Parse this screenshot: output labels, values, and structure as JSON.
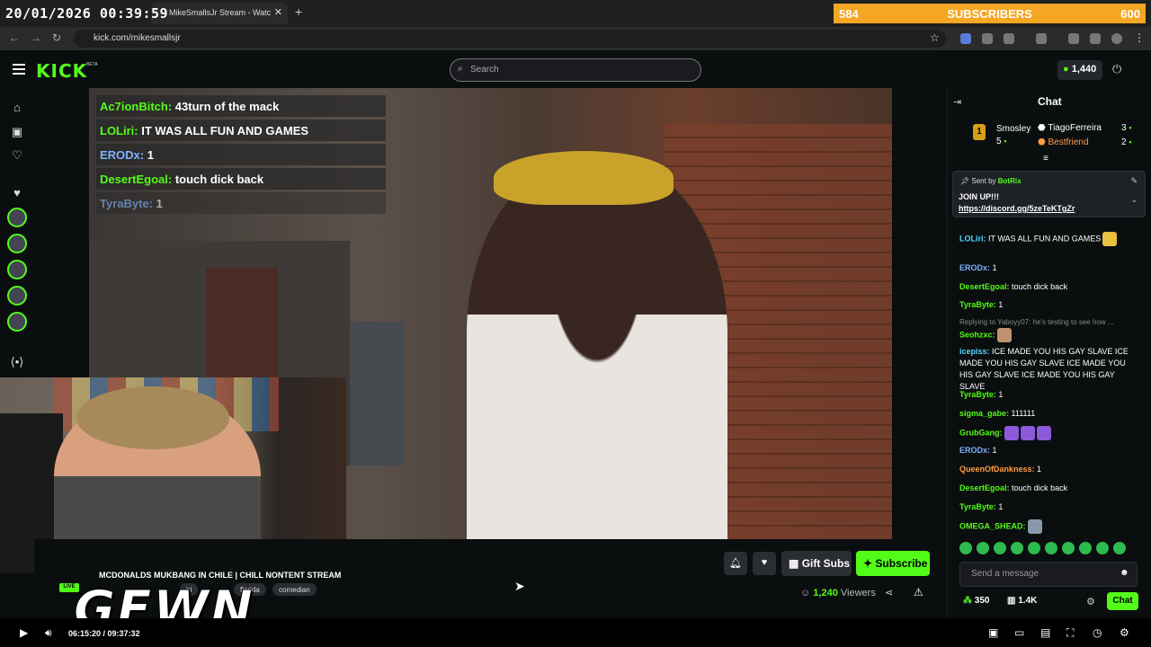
{
  "timestamp": "20/01/2026 00:39:59",
  "browser": {
    "tab_title": "MikeSmallsJr Stream - Watc",
    "url": "kick.com/mikesmallsjr"
  },
  "subscriber_bar": {
    "current": "584",
    "label": "SUBSCRIBERS",
    "goal": "600",
    "color": "#f5a623"
  },
  "header": {
    "logo": "KICK",
    "logo_badge": "BETA",
    "search_placeholder": "Search",
    "kicks_count": "1,440",
    "brand_color": "#53fc18"
  },
  "video_overlay_chat": [
    {
      "user": "Ac7ionBitch:",
      "msg": "43turn of the mack"
    },
    {
      "user": "LOLiri:",
      "msg": "IT WAS ALL FUN AND GAMES"
    },
    {
      "user": "ERODx:",
      "msg": "1"
    },
    {
      "user": "DesertEgoal:",
      "msg": "touch dick back"
    },
    {
      "user": "TyraByte:",
      "msg": "1"
    }
  ],
  "stream": {
    "title": "MCDONALDS MUKBANG IN CHILE | CHILL NONTENT STREAM",
    "live_label": "LIVE",
    "tags": [
      "iri",
      "florida",
      "comedian"
    ],
    "viewers": "1,240",
    "viewers_label": "Viewers",
    "gift_label": "Gift Subs",
    "subscribe_label": "Subscribe",
    "watermark": "GEWN"
  },
  "player": {
    "time": "06:15:20 / 09:37:32"
  },
  "chat": {
    "title": "Chat",
    "leaderboard": [
      {
        "name": "Smosley",
        "rank": "1",
        "count": "5"
      },
      {
        "name": "TiagoFerreira",
        "count": "3"
      },
      {
        "name": "Bestfriend",
        "count": "2"
      }
    ],
    "pinned": {
      "sent_by": "Sent by",
      "bot": "BotRix",
      "line1": "JOIN UP!!!",
      "link": "https://discord.gg/5zeTeKTgZr"
    },
    "messages": [
      {
        "user": "LOLiri:",
        "msg": "IT WAS ALL FUN AND GAMES"
      },
      {
        "user": "ERODx:",
        "msg": "1"
      },
      {
        "user": "DesertEgoal:",
        "msg": "touch dick back"
      },
      {
        "user": "TyraByte:",
        "msg": "1"
      },
      {
        "reply": "Replying to Yaboyy07: he's testing to see how ..."
      },
      {
        "user": "Seohzxc:",
        "msg": ""
      },
      {
        "user": "icepiss:",
        "msg": "ICE MADE YOU HIS GAY SLAVE ICE MADE YOU HIS GAY SLAVE ICE MADE YOU HIS GAY SLAVE ICE MADE YOU HIS GAY SLAVE"
      },
      {
        "user": "TyraByte:",
        "msg": "1"
      },
      {
        "user": "sigma_gabe:",
        "msg": "111111"
      },
      {
        "user": "GrubGang:",
        "msg": ""
      },
      {
        "user": "ERODx:",
        "msg": "1"
      },
      {
        "user": "QueenOfDankness:",
        "msg": "1"
      },
      {
        "user": "DesertEgoal:",
        "msg": "touch dick back"
      },
      {
        "user": "TyraByte:",
        "msg": "1"
      },
      {
        "user": "OMEGA_SHEAD:",
        "msg": ""
      }
    ],
    "input_placeholder": "Send a message",
    "points": "350",
    "store": "1.4K",
    "send_label": "Chat"
  }
}
